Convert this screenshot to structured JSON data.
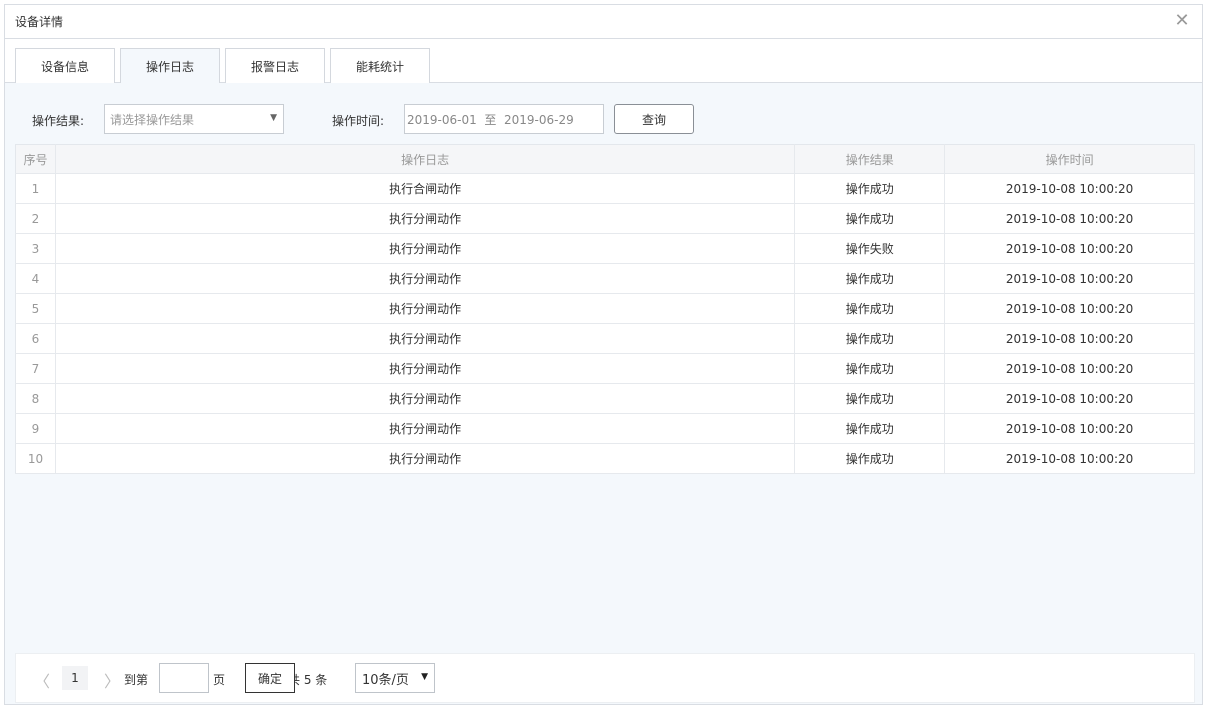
{
  "dialog": {
    "title": "设备详情",
    "close_glyph": "✕"
  },
  "tabs": [
    {
      "label": "设备信息",
      "active": false
    },
    {
      "label": "操作日志",
      "active": true
    },
    {
      "label": "报警日志",
      "active": false
    },
    {
      "label": "能耗统计",
      "active": false
    }
  ],
  "filter": {
    "result_label": "操作结果:",
    "result_placeholder": "请选择操作结果",
    "time_label": "操作时间:",
    "date_range": "2019-06-01  至  2019-06-29",
    "query_label": "查询"
  },
  "table": {
    "headers": [
      "序号",
      "操作日志",
      "操作结果",
      "操作时间"
    ],
    "rows": [
      [
        "1",
        "执行合闸动作",
        "操作成功",
        "2019-10-08 10:00:20"
      ],
      [
        "2",
        "执行分闸动作",
        "操作成功",
        "2019-10-08 10:00:20"
      ],
      [
        "3",
        "执行分闸动作",
        "操作失败",
        "2019-10-08 10:00:20"
      ],
      [
        "4",
        "执行分闸动作",
        "操作成功",
        "2019-10-08 10:00:20"
      ],
      [
        "5",
        "执行分闸动作",
        "操作成功",
        "2019-10-08 10:00:20"
      ],
      [
        "6",
        "执行分闸动作",
        "操作成功",
        "2019-10-08 10:00:20"
      ],
      [
        "7",
        "执行分闸动作",
        "操作成功",
        "2019-10-08 10:00:20"
      ],
      [
        "8",
        "执行分闸动作",
        "操作成功",
        "2019-10-08 10:00:20"
      ],
      [
        "9",
        "执行分闸动作",
        "操作成功",
        "2019-10-08 10:00:20"
      ],
      [
        "10",
        "执行分闸动作",
        "操作成功",
        "2019-10-08 10:00:20"
      ]
    ]
  },
  "pager": {
    "prev_glyph": "〈",
    "next_glyph": "〉",
    "current_page": "1",
    "goto_label": "到第",
    "page_suffix": "页",
    "confirm_label": "确定",
    "total_text": "共 5 条",
    "page_size": "10条/页",
    "size_arrow": "▼"
  },
  "colors": {
    "content_bg": "#f4f8fc",
    "border": "#d9dde3",
    "header_bg": "#f5f6f8"
  }
}
